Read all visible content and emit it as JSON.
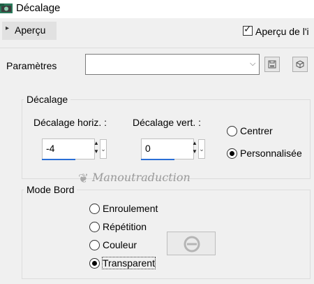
{
  "window": {
    "title": "Décalage"
  },
  "preview": {
    "expander_label": "Aperçu",
    "checkbox_label": "Aperçu de l'i",
    "checkbox_checked": true
  },
  "presets": {
    "label": "Paramètres",
    "value": "",
    "save_icon": "save-icon",
    "reset_icon": "reset-icon"
  },
  "offset": {
    "group_label": "Décalage",
    "horiz_label": "Décalage horiz. :",
    "horiz_value": "-4",
    "vert_label": "Décalage vert. :",
    "vert_value": "0",
    "center_label": "Centrer",
    "custom_label": "Personnalisée",
    "selected": "custom"
  },
  "edge_mode": {
    "group_label": "Mode Bord",
    "options": [
      "Enroulement",
      "Répétition",
      "Couleur",
      "Transparent"
    ],
    "selected": "Transparent",
    "color_icon": "no-color-icon"
  },
  "watermark": "Manoutraduction",
  "colors": {
    "accent": "#2a6fd6",
    "background": "#f0f0f0"
  }
}
